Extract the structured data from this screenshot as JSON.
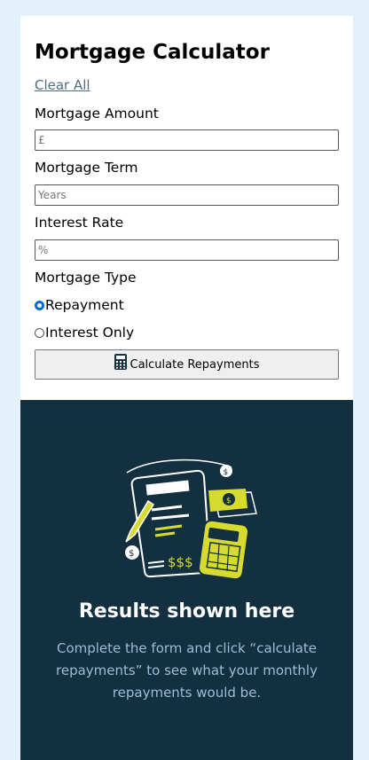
{
  "form": {
    "title": "Mortgage Calculator",
    "clear_label": "Clear All",
    "amount": {
      "label": "Mortgage Amount",
      "placeholder": "£"
    },
    "term": {
      "label": "Mortgage Term",
      "placeholder": "Years"
    },
    "rate": {
      "label": "Interest Rate",
      "placeholder": "%"
    },
    "type": {
      "label": "Mortgage Type",
      "options": [
        {
          "label": "Repayment",
          "selected": true
        },
        {
          "label": "Interest Only",
          "selected": false
        }
      ]
    },
    "submit_label": "Calculate Repayments",
    "submit_icon": "calculator-icon"
  },
  "results": {
    "illustration": "empty-results-illustration",
    "title": "Results shown here",
    "text": "Complete the form and click “calculate repayments” to see what your monthly repayments would be."
  },
  "colors": {
    "page_bg": "#e3f1fc",
    "results_bg": "#133041",
    "accent": "#d8db2f",
    "results_text": "#9abed5",
    "radio_selected": "#0a6cdb"
  }
}
